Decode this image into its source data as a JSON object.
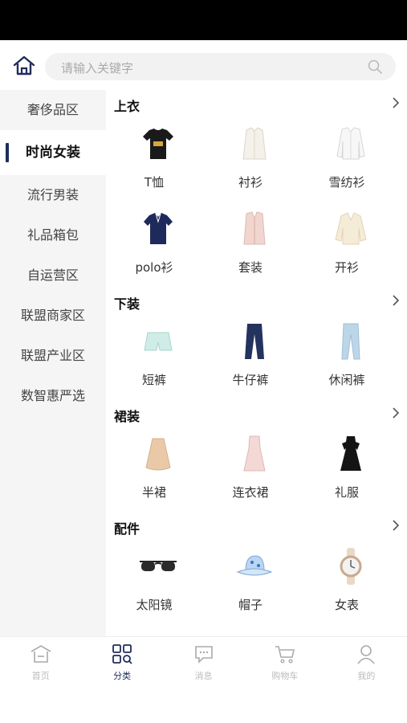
{
  "search": {
    "placeholder": "请输入关键字"
  },
  "sidebar": {
    "items": [
      {
        "label": "奢侈品区"
      },
      {
        "label": "时尚女装",
        "active": true
      },
      {
        "label": "流行男装"
      },
      {
        "label": "礼品箱包"
      },
      {
        "label": "自运营区"
      },
      {
        "label": "联盟商家区"
      },
      {
        "label": "联盟产业区"
      },
      {
        "label": "数智惠严选"
      }
    ]
  },
  "sections": [
    {
      "title": "上衣",
      "items": [
        {
          "label": "T恤",
          "icon": "tshirt-icon"
        },
        {
          "label": "衬衫",
          "icon": "shirt-icon"
        },
        {
          "label": "雪纺衫",
          "icon": "chiffon-blouse-icon"
        },
        {
          "label": "polo衫",
          "icon": "polo-shirt-icon"
        },
        {
          "label": "套装",
          "icon": "suit-icon"
        },
        {
          "label": "开衫",
          "icon": "cardigan-icon"
        }
      ]
    },
    {
      "title": "下装",
      "items": [
        {
          "label": "短裤",
          "icon": "shorts-icon"
        },
        {
          "label": "牛仔裤",
          "icon": "jeans-icon"
        },
        {
          "label": "休闲裤",
          "icon": "casual-pants-icon"
        }
      ]
    },
    {
      "title": "裙装",
      "items": [
        {
          "label": "半裙",
          "icon": "skirt-icon"
        },
        {
          "label": "连衣裙",
          "icon": "dress-icon"
        },
        {
          "label": "礼服",
          "icon": "gown-icon"
        }
      ]
    },
    {
      "title": "配件",
      "items": [
        {
          "label": "太阳镜",
          "icon": "sunglasses-icon"
        },
        {
          "label": "帽子",
          "icon": "hat-icon"
        },
        {
          "label": "女表",
          "icon": "watch-icon"
        }
      ]
    }
  ],
  "tabbar": {
    "tabs": [
      {
        "label": "首页",
        "icon": "home-icon"
      },
      {
        "label": "分类",
        "icon": "category-icon",
        "active": true
      },
      {
        "label": "消息",
        "icon": "message-icon"
      },
      {
        "label": "购物车",
        "icon": "cart-icon"
      },
      {
        "label": "我的",
        "icon": "profile-icon"
      }
    ]
  },
  "colors": {
    "accent": "#1f2d5a",
    "sidebar_bg": "#f5f5f5",
    "inactive_tab": "#bbbbbb"
  }
}
